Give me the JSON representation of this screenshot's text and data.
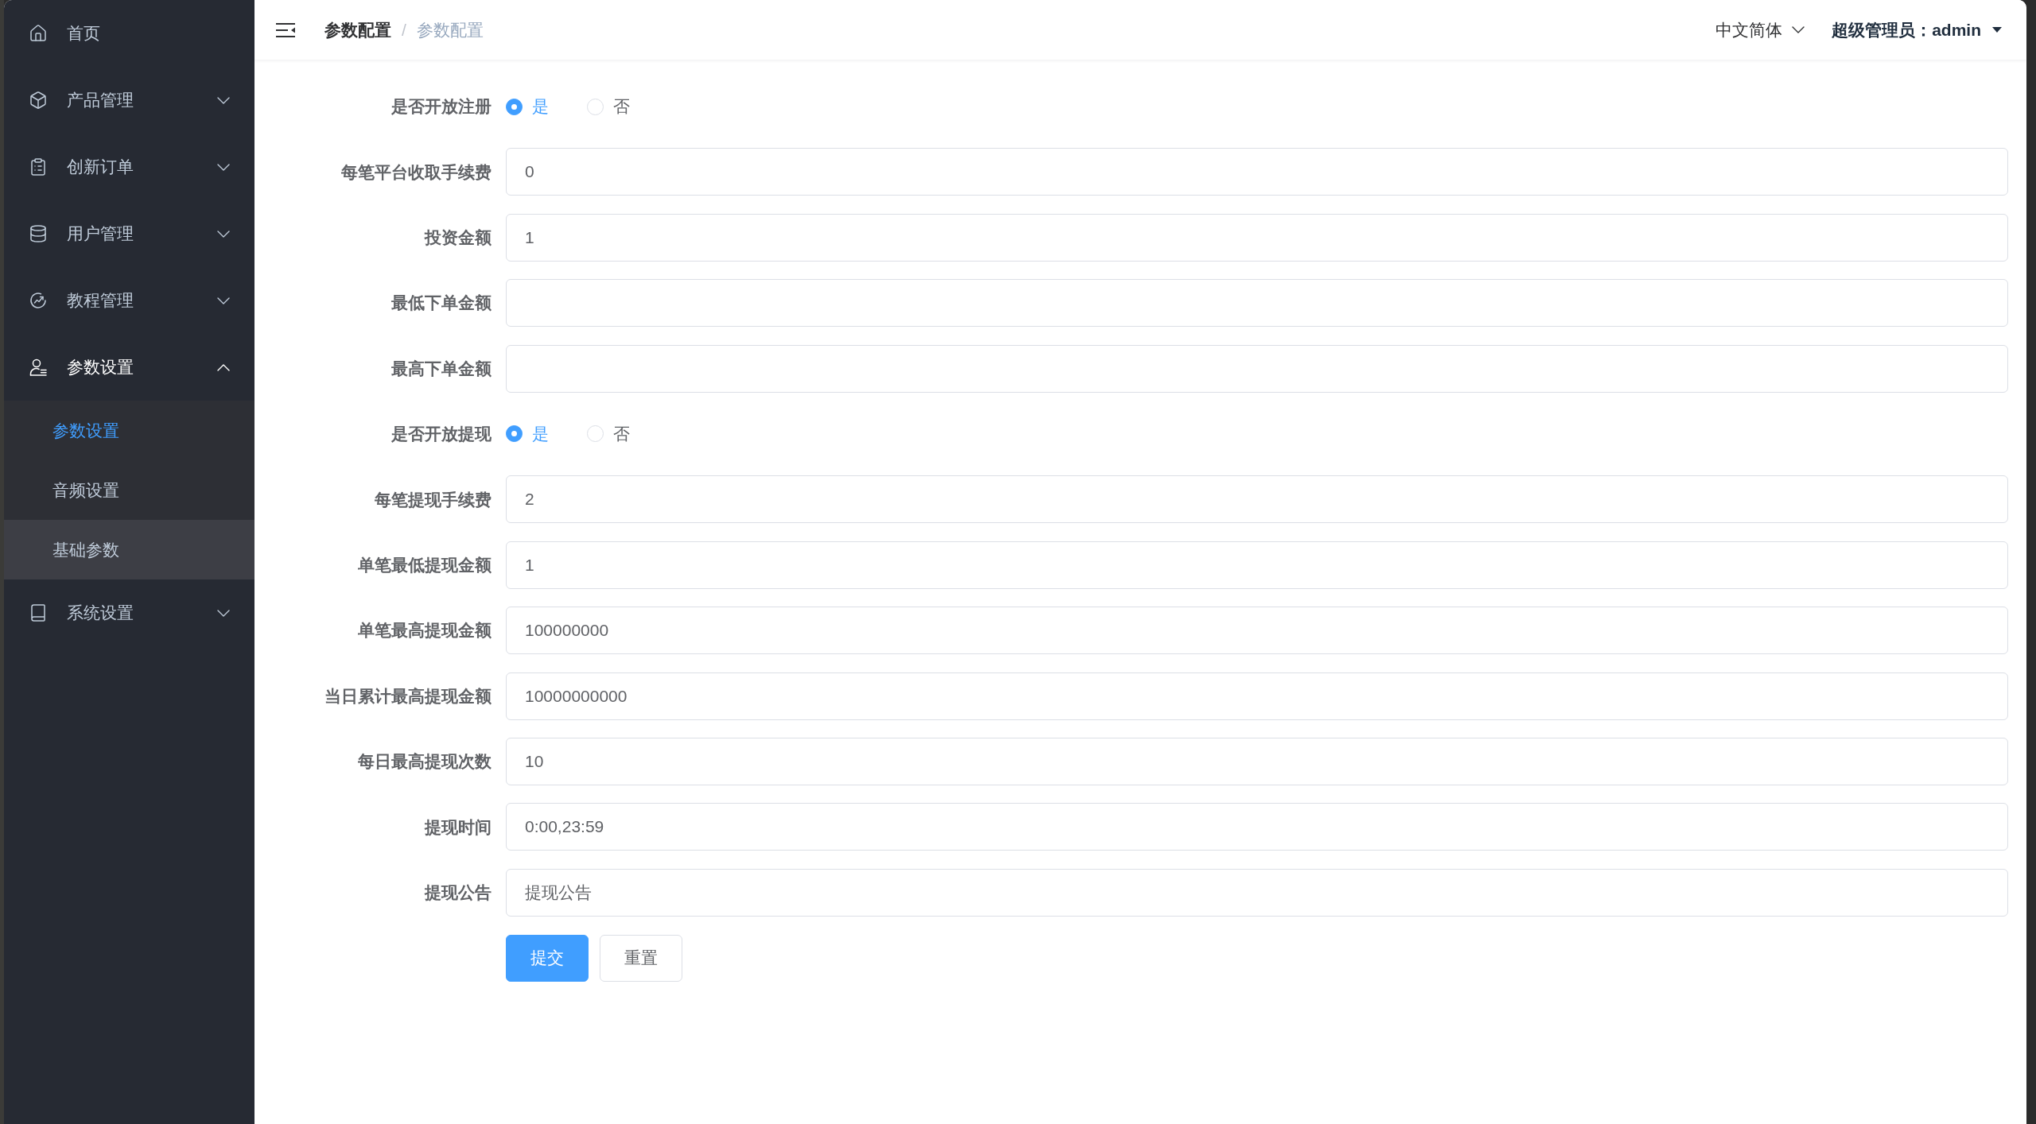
{
  "sidebar": {
    "items": [
      {
        "label": "首页",
        "kind": "link"
      },
      {
        "label": "产品管理",
        "kind": "submenu",
        "expanded": false
      },
      {
        "label": "创新订单",
        "kind": "submenu",
        "expanded": false
      },
      {
        "label": "用户管理",
        "kind": "submenu",
        "expanded": false
      },
      {
        "label": "教程管理",
        "kind": "submenu",
        "expanded": false
      },
      {
        "label": "参数设置",
        "kind": "submenu",
        "expanded": true,
        "children": [
          {
            "label": "参数设置",
            "selected": true,
            "hovered": false
          },
          {
            "label": "音频设置",
            "selected": false,
            "hovered": false
          },
          {
            "label": "基础参数",
            "selected": false,
            "hovered": true
          }
        ]
      },
      {
        "label": "系统设置",
        "kind": "submenu",
        "expanded": false
      }
    ]
  },
  "header": {
    "breadcrumb": {
      "separator": "/",
      "items": [
        {
          "label": "参数配置",
          "current": false
        },
        {
          "label": "参数配置",
          "current": true
        }
      ]
    },
    "language": "中文简体",
    "user": "超级管理员：admin"
  },
  "form": {
    "fields": [
      {
        "label": "是否开放注册",
        "kind": "radio",
        "options": [
          {
            "label": "是",
            "selected": true
          },
          {
            "label": "否",
            "selected": false
          }
        ]
      },
      {
        "label": "每笔平台收取手续费",
        "kind": "text",
        "value": "0"
      },
      {
        "label": "投资金额",
        "kind": "text",
        "value": "1"
      },
      {
        "label": "最低下单金额",
        "kind": "text"
      },
      {
        "label": "最高下单金额",
        "kind": "text"
      },
      {
        "label": "是否开放提现",
        "kind": "radio",
        "options": [
          {
            "label": "是",
            "selected": true
          },
          {
            "label": "否",
            "selected": false
          }
        ]
      },
      {
        "label": "每笔提现手续费",
        "kind": "text",
        "value": "2"
      },
      {
        "label": "单笔最低提现金额",
        "kind": "text",
        "value": "1"
      },
      {
        "label": "单笔最高提现金额",
        "kind": "text",
        "value": "100000000"
      },
      {
        "label": "当日累计最高提现金额",
        "kind": "text",
        "value": "10000000000"
      },
      {
        "label": "每日最高提现次数",
        "kind": "text",
        "value": "10"
      },
      {
        "label": "提现时间",
        "kind": "text",
        "value": "0:00,23:59"
      },
      {
        "label": "提现公告",
        "kind": "text",
        "value": "提现公告"
      }
    ],
    "buttons": [
      {
        "label": "提交",
        "kind": "primary"
      },
      {
        "label": "重置",
        "kind": "default"
      }
    ]
  }
}
